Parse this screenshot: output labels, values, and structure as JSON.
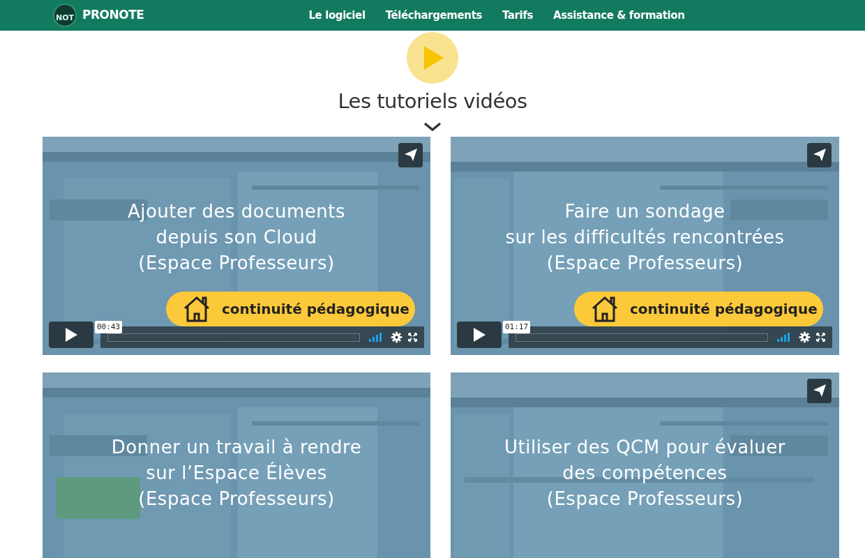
{
  "navbar": {
    "logo_badge": "NOT",
    "brand": "PRONOTE",
    "links": [
      {
        "label": "Le logiciel"
      },
      {
        "label": "Téléchargements"
      },
      {
        "label": "Tarifs"
      },
      {
        "label": "Assistance & formation"
      }
    ]
  },
  "heading": "Les tutoriels vidéos",
  "videos": [
    {
      "title": "Ajouter des documents\ndepuis son Cloud\n(Espace Professeurs)",
      "share": true,
      "duration": "00:43",
      "badge": "continuité pédagogique"
    },
    {
      "title": "Faire un sondage\nsur les difficultés rencontrées\n(Espace Professeurs)",
      "share": true,
      "duration": "01:17",
      "badge": "continuité pédagogique"
    },
    {
      "title": "Donner un travail à rendre\nsur l’Espace Élèves\n(Espace Professeurs)",
      "share": false
    },
    {
      "title": "Utiliser des QCM pour évaluer\ndes compétences\n(Espace Professeurs)",
      "share": true
    }
  ]
}
